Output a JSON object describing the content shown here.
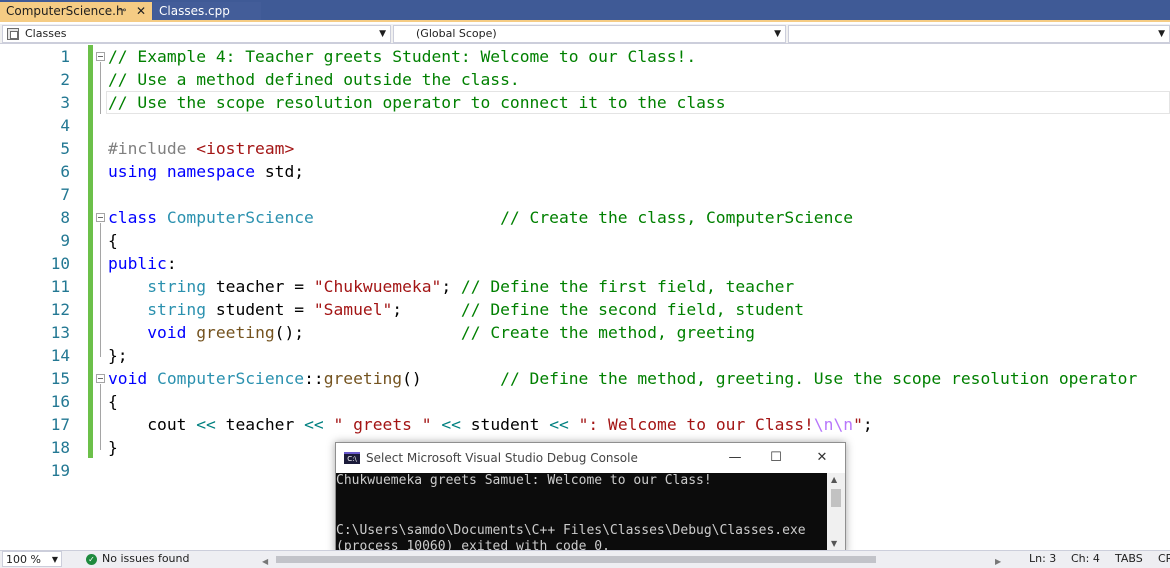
{
  "tabs": [
    {
      "label": "ComputerScience.h",
      "active": true,
      "pin": "⊸",
      "close": "✕"
    },
    {
      "label": "Classes.cpp",
      "active": false
    }
  ],
  "navbar": {
    "project": "Classes",
    "scope": "(Global Scope)",
    "member": ""
  },
  "code_lines": [
    {
      "num": "1",
      "fold": true,
      "segments": [
        {
          "cls": "cm",
          "text": "// Example 4: Teacher greets Student: Welcome to our Class!."
        }
      ]
    },
    {
      "num": "2",
      "segments": [
        {
          "cls": "cm",
          "text": "// Use a method defined outside the class."
        }
      ]
    },
    {
      "num": "3",
      "segments": [
        {
          "cls": "cm",
          "text": "// Use the scope resolution operator to connect it to the class"
        }
      ]
    },
    {
      "num": "4",
      "segments": []
    },
    {
      "num": "5",
      "segments": [
        {
          "cls": "pp",
          "text": "#include "
        },
        {
          "cls": "st",
          "text": "<iostream>"
        }
      ]
    },
    {
      "num": "6",
      "segments": [
        {
          "cls": "kw",
          "text": "using"
        },
        {
          "cls": "",
          "text": " "
        },
        {
          "cls": "kw",
          "text": "namespace"
        },
        {
          "cls": "",
          "text": " std;"
        }
      ]
    },
    {
      "num": "7",
      "segments": []
    },
    {
      "num": "8",
      "fold": true,
      "segments": [
        {
          "cls": "kw",
          "text": "class"
        },
        {
          "cls": "",
          "text": " "
        },
        {
          "cls": "ty",
          "text": "ComputerScience"
        },
        {
          "cls": "",
          "text": "                   "
        },
        {
          "cls": "cm",
          "text": "// Create the class, ComputerScience"
        }
      ]
    },
    {
      "num": "9",
      "segments": [
        {
          "cls": "",
          "text": "{"
        }
      ]
    },
    {
      "num": "10",
      "segments": [
        {
          "cls": "kw",
          "text": "public"
        },
        {
          "cls": "",
          "text": ":"
        }
      ]
    },
    {
      "num": "11",
      "segments": [
        {
          "cls": "",
          "text": "    "
        },
        {
          "cls": "ty",
          "text": "string"
        },
        {
          "cls": "",
          "text": " teacher = "
        },
        {
          "cls": "st",
          "text": "\"Chukwuemeka\""
        },
        {
          "cls": "",
          "text": "; "
        },
        {
          "cls": "cm",
          "text": "// Define the first field, teacher"
        }
      ]
    },
    {
      "num": "12",
      "segments": [
        {
          "cls": "",
          "text": "    "
        },
        {
          "cls": "ty",
          "text": "string"
        },
        {
          "cls": "",
          "text": " student = "
        },
        {
          "cls": "st",
          "text": "\"Samuel\""
        },
        {
          "cls": "",
          "text": ";      "
        },
        {
          "cls": "cm",
          "text": "// Define the second field, student"
        }
      ]
    },
    {
      "num": "13",
      "segments": [
        {
          "cls": "",
          "text": "    "
        },
        {
          "cls": "kw",
          "text": "void"
        },
        {
          "cls": "",
          "text": " "
        },
        {
          "cls": "fn",
          "text": "greeting"
        },
        {
          "cls": "",
          "text": "();                "
        },
        {
          "cls": "cm",
          "text": "// Create the method, greeting"
        }
      ]
    },
    {
      "num": "14",
      "segments": [
        {
          "cls": "",
          "text": "};"
        }
      ]
    },
    {
      "num": "15",
      "fold": true,
      "segments": [
        {
          "cls": "kw",
          "text": "void"
        },
        {
          "cls": "",
          "text": " "
        },
        {
          "cls": "ty",
          "text": "ComputerScience"
        },
        {
          "cls": "",
          "text": "::"
        },
        {
          "cls": "fn",
          "text": "greeting"
        },
        {
          "cls": "",
          "text": "()        "
        },
        {
          "cls": "cm",
          "text": "// Define the method, greeting. Use the scope resolution operator"
        }
      ]
    },
    {
      "num": "16",
      "segments": [
        {
          "cls": "",
          "text": "{"
        }
      ]
    },
    {
      "num": "17",
      "segments": [
        {
          "cls": "",
          "text": "    cout "
        },
        {
          "cls": "op",
          "text": "<<"
        },
        {
          "cls": "",
          "text": " teacher "
        },
        {
          "cls": "op",
          "text": "<<"
        },
        {
          "cls": "",
          "text": " "
        },
        {
          "cls": "st",
          "text": "\" greets \""
        },
        {
          "cls": "",
          "text": " "
        },
        {
          "cls": "op",
          "text": "<<"
        },
        {
          "cls": "",
          "text": " student "
        },
        {
          "cls": "op",
          "text": "<<"
        },
        {
          "cls": "",
          "text": " "
        },
        {
          "cls": "st",
          "text": "\": Welcome to our Class!"
        },
        {
          "cls": "es",
          "text": "\\n\\n"
        },
        {
          "cls": "st",
          "text": "\""
        },
        {
          "cls": "",
          "text": ";"
        }
      ]
    },
    {
      "num": "18",
      "segments": [
        {
          "cls": "",
          "text": "}"
        }
      ]
    },
    {
      "num": "19",
      "segments": []
    }
  ],
  "console": {
    "title": "Select Microsoft Visual Studio Debug Console",
    "icon_label": "C:\\",
    "minimize": "—",
    "maximize": "☐",
    "close": "✕",
    "output": "Chukwuemeka greets Samuel: Welcome to our Class!\n\n\nC:\\Users\\samdo\\Documents\\C++ Files\\Classes\\Debug\\Classes.exe\n(process 10060) exited with code 0."
  },
  "statusbar": {
    "zoom": "100 %",
    "issues": "No issues found",
    "ln": "Ln: 3",
    "ch": "Ch: 4",
    "tabs": "TABS",
    "encoding": "CR"
  },
  "colors": {
    "tab_active": "#f5cc84",
    "tabstrip": "#3f5a96",
    "comment": "#008000",
    "keyword": "#0000ff",
    "type": "#2b91af",
    "string": "#a31515",
    "change_bar": "#6cc04a"
  }
}
